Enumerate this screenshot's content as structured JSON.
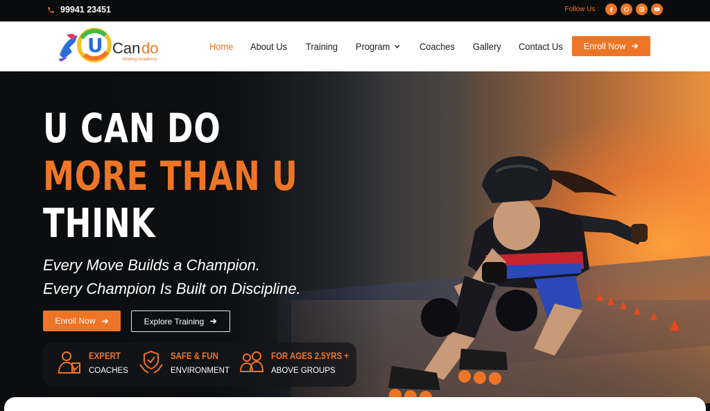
{
  "topbar": {
    "phone": "99941 23451",
    "follow_label": "Follow Us :",
    "social_icons": [
      "facebook-icon",
      "whatsapp-icon",
      "instagram-icon",
      "youtube-icon"
    ]
  },
  "brand": {
    "logo_text": "Cando",
    "logo_letter": "U",
    "logo_sub": "Skating Academy",
    "accent": "#ee7526",
    "dark": "#0a0b0d"
  },
  "nav": {
    "items": [
      {
        "label": "Home",
        "active": true
      },
      {
        "label": "About Us"
      },
      {
        "label": "Training"
      },
      {
        "label": "Program",
        "has_dropdown": true
      },
      {
        "label": "Coaches"
      },
      {
        "label": "Gallery"
      },
      {
        "label": "Contact Us"
      }
    ],
    "enroll_label": "Enroll Now"
  },
  "hero": {
    "line1": "U CAN DO",
    "line2": "MORE THAN U",
    "line3": "THINK",
    "tagline1": "Every Move Builds a Champion.",
    "tagline2": "Every Champion Is Built on Discipline.",
    "enroll_label": "Enroll Now",
    "explore_label": "Explore Training"
  },
  "features": [
    {
      "title": "EXPERT",
      "sub": "COACHES",
      "icon": "coach-icon"
    },
    {
      "title": "SAFE & FUN",
      "sub": "ENVIRONMENT",
      "icon": "shield-hands-icon"
    },
    {
      "title": "FOR AGES 2.5YRS +",
      "sub": "ABOVE GROUPS",
      "icon": "group-icon"
    }
  ]
}
